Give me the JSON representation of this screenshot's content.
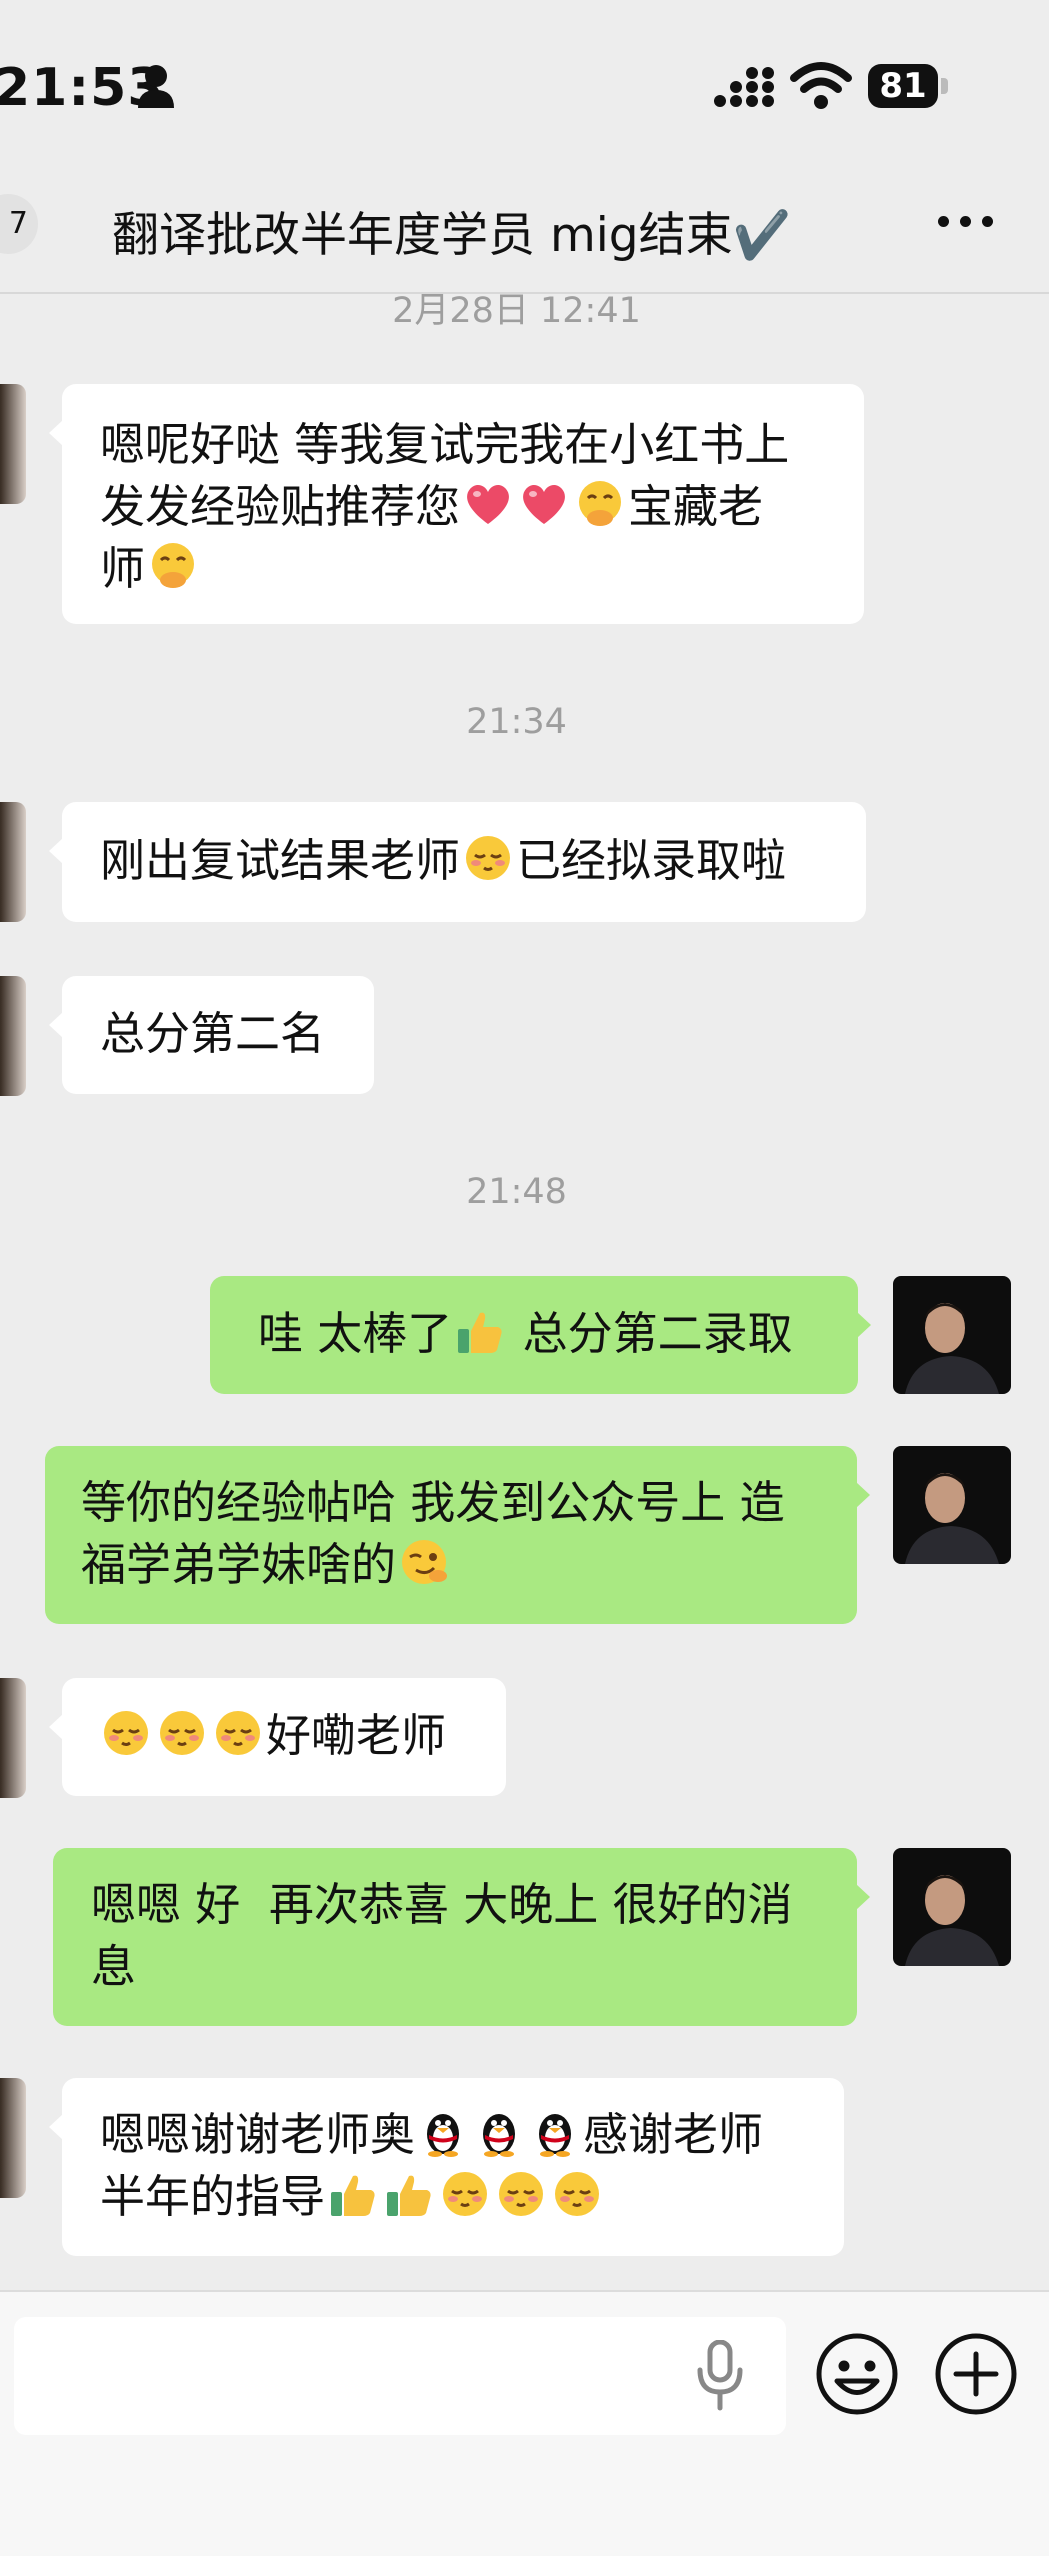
{
  "status_bar": {
    "time": "21:53",
    "battery": "81"
  },
  "header": {
    "back_badge": "7",
    "title": "翻译批改半年度学员 mig结束✔️"
  },
  "timestamps": [
    "2月28日 12:41",
    "21:34",
    "21:48"
  ],
  "messages": [
    {
      "side": "left",
      "lines": [
        "嗯呢好哒 等我复试完我在小红书上",
        "发发经验贴推荐您[heart][heart][shush]宝藏老",
        "师[shush]"
      ]
    },
    {
      "side": "left",
      "lines": [
        "刚出复试结果老师[shy]已经拟录取啦"
      ]
    },
    {
      "side": "left",
      "lines": [
        "总分第二名"
      ]
    },
    {
      "side": "right",
      "lines": [
        "哇 太棒了[thumb] 总分第二录取"
      ]
    },
    {
      "side": "right",
      "lines": [
        "等你的经验帖哈 我发到公众号上 造",
        "福学弟学妹啥的[wink]"
      ]
    },
    {
      "side": "left",
      "lines": [
        "[shy][shy][shy]好嘞老师"
      ]
    },
    {
      "side": "right",
      "lines": [
        "嗯嗯 好  再次恭喜 大晚上 很好的消",
        "息"
      ]
    },
    {
      "side": "left",
      "lines": [
        "嗯嗯谢谢老师奥[penguin][penguin][penguin]感谢老师",
        "半年的指导[thumb][thumb][shy][shy][shy]"
      ]
    }
  ],
  "input": {
    "placeholder": ""
  },
  "icons": [
    "person-icon",
    "signal-icon",
    "wifi-icon",
    "battery-icon",
    "more-icon",
    "heart-emoji",
    "shush-emoji",
    "shy-emoji",
    "thumb-emoji",
    "wink-emoji",
    "penguin-emoji",
    "mic-icon",
    "emoji-icon",
    "plus-icon"
  ],
  "colors": {
    "background": "#ededed",
    "bubble_left": "#ffffff",
    "bubble_right": "#a9e982",
    "timestamp": "#9e9e9e"
  }
}
